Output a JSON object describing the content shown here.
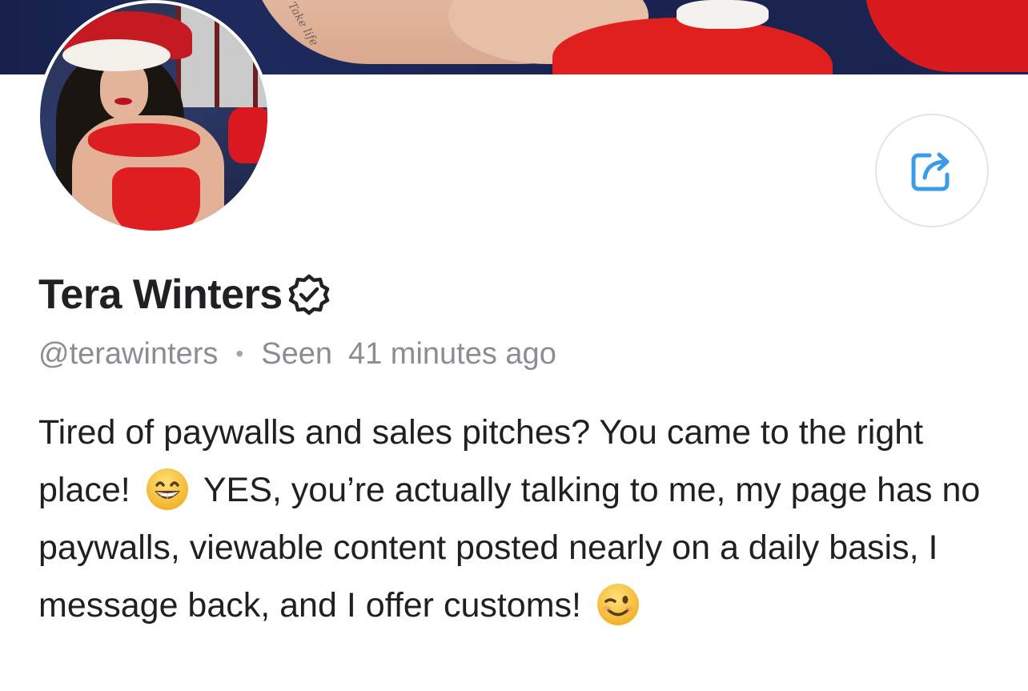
{
  "profile": {
    "display_name": "Tera Winters",
    "handle": "@terawinters",
    "separator": "•",
    "seen_label": "Seen",
    "seen_time": "41 minutes ago",
    "verified": true
  },
  "bio": {
    "part1": "Tired of paywalls and sales pitches? You came to the right place!",
    "emoji1": "grinning-face-with-smiling-eyes",
    "part2": "YES, you’re actually talking to me, my page has no paywalls, viewable content posted nearly on a daily basis, I message back, and I offer customs!",
    "emoji2": "winking-face"
  },
  "cover": {
    "tattoo_text": "Take life"
  },
  "actions": {
    "share_icon": "share-icon"
  },
  "colors": {
    "accent": "#3b9be8",
    "text_primary": "#202124",
    "text_muted": "#8a8d95",
    "emoji_yellow": "#f7c234"
  }
}
